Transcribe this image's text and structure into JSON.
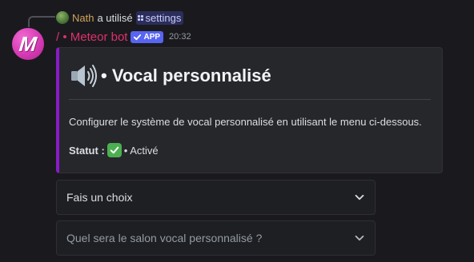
{
  "reply": {
    "user": "Nath",
    "text": "a utilisé",
    "command": "settings"
  },
  "message": {
    "author": "/ • Meteor bot",
    "app_tag": "APP",
    "timestamp": "20:32",
    "avatar_letter": "M"
  },
  "embed": {
    "accent_color": "#8a1ac7",
    "title": "• Vocal personnalisé",
    "title_icon": "speaker-loud-icon",
    "description": "Configurer le système de vocal personnalisé en utilisant le menu ci-dessous.",
    "status_label": "Statut :",
    "status_icon": "check-mark-button-icon",
    "status_value": "• Activé"
  },
  "selects": [
    {
      "text": "Fais un choix"
    },
    {
      "text": "Quel sera le salon vocal personnalisé ?"
    }
  ],
  "colors": {
    "background": "#1a1a1e",
    "author_name": "#e0306b",
    "app_tag": "#5865f2",
    "reply_user": "#cfa35a"
  }
}
